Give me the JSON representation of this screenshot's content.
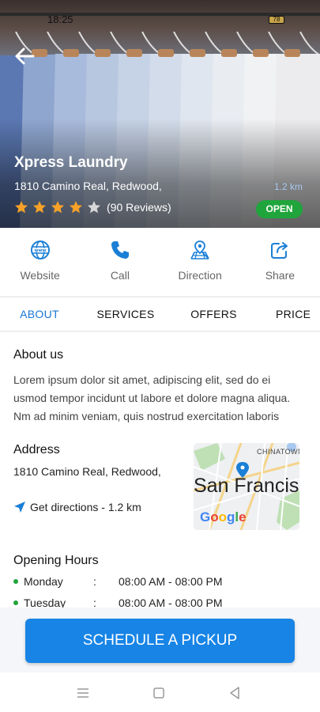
{
  "status_bar": {
    "time": "18:25",
    "battery": "78"
  },
  "store": {
    "name": "Xpress Laundry",
    "address": "1810 Camino Real, Redwood,",
    "distance": "1.2 km",
    "rating": 4,
    "rating_max": 5,
    "reviews": "(90 Reviews)",
    "status": "OPEN"
  },
  "actions": [
    {
      "label": "Website",
      "icon": "globe-icon"
    },
    {
      "label": "Call",
      "icon": "phone-icon"
    },
    {
      "label": "Direction",
      "icon": "map-pin-icon"
    },
    {
      "label": "Share",
      "icon": "share-icon"
    }
  ],
  "tabs": [
    {
      "label": "ABOUT",
      "active": true
    },
    {
      "label": "SERVICES",
      "active": false
    },
    {
      "label": "OFFERS",
      "active": false
    },
    {
      "label": "PRICE LIST",
      "active": false
    }
  ],
  "about": {
    "heading": "About us",
    "text": "Lorem ipsum dolor sit amet, adipiscing elit, sed do ei usmod tempor incidunt ut labore et dolore magna aliqua. Nm ad minim veniam, quis nostrud exercitation laboris"
  },
  "address_section": {
    "heading": "Address",
    "address": "1810 Camino Real, Redwood,",
    "directions": "Get directions - 1.2 km",
    "map": {
      "city_label": "San Francis",
      "neighborhood": "CHINATOWN",
      "logo": "Google"
    }
  },
  "opening_hours": {
    "heading": "Opening Hours",
    "rows": [
      {
        "day": "Monday",
        "sep": ":",
        "hours": "08:00 AM - 08:00 PM"
      },
      {
        "day": "Tuesday",
        "sep": ":",
        "hours": "08:00 AM - 08:00 PM"
      }
    ]
  },
  "cta": {
    "label": "SCHEDULE A PICKUP"
  },
  "colors": {
    "accent": "#1784e6",
    "open_badge": "#1fa53b",
    "star": "#f7a128",
    "tab_active": "#1877d3"
  }
}
